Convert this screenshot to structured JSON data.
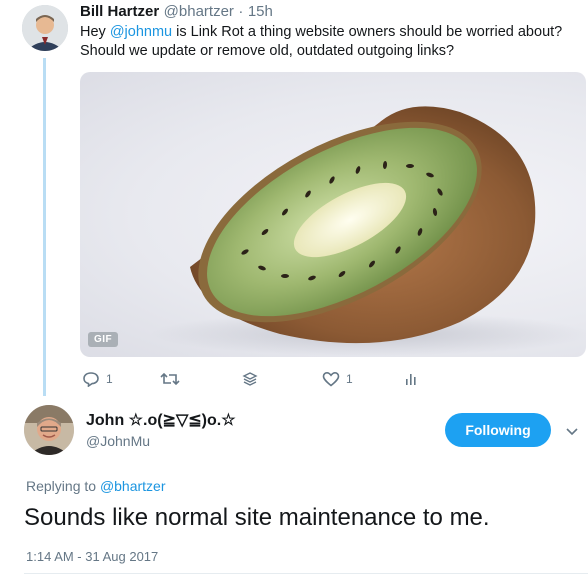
{
  "tweet": {
    "author_name": "Bill Hartzer",
    "author_handle": "@bhartzer",
    "separator": "·",
    "time": "15h",
    "text_before": "Hey ",
    "mention": "@johnmu",
    "text_after_line1": " is Link Rot a thing website owners should be worried about?",
    "text_line2": "Should we update or remove old, outdated outgoing links?",
    "media_badge": "GIF",
    "actions": {
      "reply_count": "1",
      "retweet_count": "",
      "like_count": "1"
    }
  },
  "reply": {
    "author_name": "John ☆.o(≧▽≦)o.☆",
    "author_handle": "@JohnMu",
    "follow_label": "Following",
    "replying_to_label": "Replying to",
    "replying_to_handle": "@bhartzer",
    "text": "Sounds like normal site maintenance to me.",
    "timestamp": "1:14 AM - 31 Aug 2017"
  },
  "colors": {
    "accent": "#1da1f2",
    "link": "#1b95e0",
    "muted": "#657786",
    "thread_line": "#b9ddf4"
  }
}
